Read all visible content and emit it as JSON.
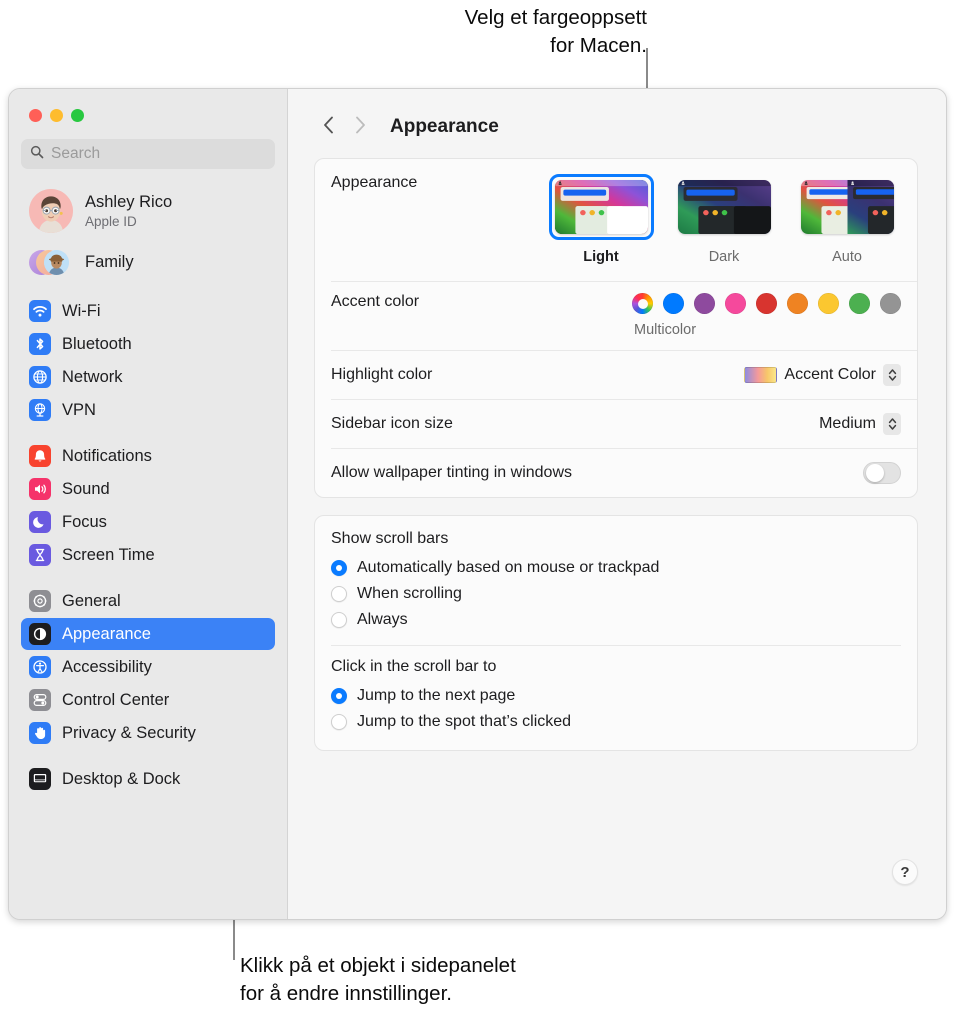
{
  "callouts": {
    "top": "Velg et fargeoppsett\nfor Macen.",
    "bottom": "Klikk på et objekt i sidepanelet\nfor å endre innstillinger."
  },
  "sidebar": {
    "search": {
      "placeholder": "Search",
      "value": ""
    },
    "account": {
      "name": "Ashley Rico",
      "subtitle": "Apple ID"
    },
    "family": {
      "label": "Family"
    },
    "groups": [
      {
        "items": [
          {
            "label": "Wi-Fi",
            "icon": "wifi-icon",
            "color": "#2f7cf6"
          },
          {
            "label": "Bluetooth",
            "icon": "bluetooth-icon",
            "color": "#2f7cf6"
          },
          {
            "label": "Network",
            "icon": "globe-icon",
            "color": "#2f7cf6"
          },
          {
            "label": "VPN",
            "icon": "vpn-globe-icon",
            "color": "#2f7cf6"
          }
        ]
      },
      {
        "items": [
          {
            "label": "Notifications",
            "icon": "bell-icon",
            "color": "#f8432e"
          },
          {
            "label": "Sound",
            "icon": "speaker-icon",
            "color": "#f5336a"
          },
          {
            "label": "Focus",
            "icon": "moon-icon",
            "color": "#6a5ae0"
          },
          {
            "label": "Screen Time",
            "icon": "hourglass-icon",
            "color": "#6a5ae0"
          }
        ]
      },
      {
        "items": [
          {
            "label": "General",
            "icon": "gear-icon",
            "color": "#8e8e93"
          },
          {
            "label": "Appearance",
            "icon": "appearance-contrast-icon",
            "color": "#1d1d1f",
            "selected": true
          },
          {
            "label": "Accessibility",
            "icon": "accessibility-icon",
            "color": "#2f7cf6"
          },
          {
            "label": "Control Center",
            "icon": "control-center-icon",
            "color": "#8e8e93"
          },
          {
            "label": "Privacy & Security",
            "icon": "hand-icon",
            "color": "#2f7cf6"
          }
        ]
      },
      {
        "items": [
          {
            "label": "Desktop & Dock",
            "icon": "desktop-dock-icon",
            "color": "#1d1d1f"
          }
        ]
      }
    ]
  },
  "detail": {
    "back_icon": "chevron-left-icon",
    "forward_icon": "chevron-right-icon",
    "title": "Appearance",
    "appearance": {
      "label": "Appearance",
      "options": [
        {
          "name": "Light",
          "selected": true
        },
        {
          "name": "Dark",
          "selected": false
        },
        {
          "name": "Auto",
          "selected": false
        }
      ]
    },
    "accent": {
      "label": "Accent color",
      "caption": "Multicolor",
      "swatches": [
        {
          "name": "multicolor",
          "color": "multicolor",
          "selected": true
        },
        {
          "name": "blue",
          "color": "#007aff"
        },
        {
          "name": "purple",
          "color": "#8e4a9e"
        },
        {
          "name": "pink",
          "color": "#f5499c"
        },
        {
          "name": "red",
          "color": "#d8342f"
        },
        {
          "name": "orange",
          "color": "#ef8322"
        },
        {
          "name": "yellow",
          "color": "#fbc730"
        },
        {
          "name": "green",
          "color": "#4cb050"
        },
        {
          "name": "graphite",
          "color": "#949494"
        }
      ]
    },
    "highlight": {
      "label": "Highlight color",
      "value": "Accent Color"
    },
    "sidebar_icon_size": {
      "label": "Sidebar icon size",
      "value": "Medium"
    },
    "wallpaper_tinting": {
      "label": "Allow wallpaper tinting in windows",
      "state": "off"
    },
    "scroll_bars": {
      "title": "Show scroll bars",
      "options": [
        {
          "label": "Automatically based on mouse or trackpad",
          "selected": true
        },
        {
          "label": "When scrolling",
          "selected": false
        },
        {
          "label": "Always",
          "selected": false
        }
      ]
    },
    "scroll_click": {
      "title": "Click in the scroll bar to",
      "options": [
        {
          "label": "Jump to the next page",
          "selected": true
        },
        {
          "label": "Jump to the spot that’s clicked",
          "selected": false
        }
      ]
    },
    "help": {
      "label": "?"
    }
  }
}
